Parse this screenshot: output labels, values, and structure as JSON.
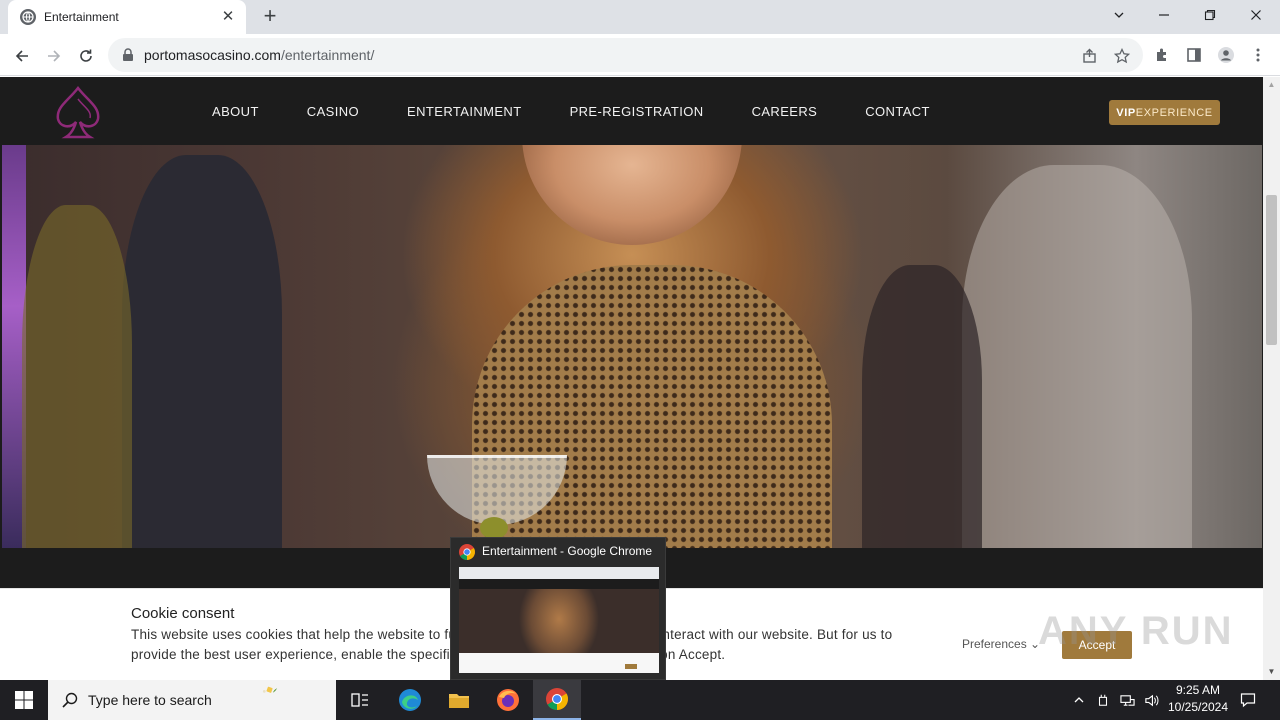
{
  "browser": {
    "tab_title": "Entertainment",
    "new_tab_label": "+",
    "url_host": "portomasocasino.com",
    "url_path": "/entertainment/"
  },
  "site": {
    "nav": [
      "ABOUT",
      "CASINO",
      "ENTERTAINMENT",
      "PRE-REGISTRATION",
      "CAREERS",
      "CONTACT"
    ],
    "vip_bold": "VIP",
    "vip_rest": "EXPERIENCE",
    "colors": {
      "header_bg": "#1c1c1c",
      "accent_gold": "#a07a3c",
      "logo_purple": "#8e2a78"
    }
  },
  "cookie": {
    "title": "Cookie consent",
    "text": "This website uses cookies that help the website to function and also to track how you interact with our website. But for us to provide the best user experience, enable the specific cookies from Settings, and click on Accept.",
    "preferences": "Preferences",
    "accept": "Accept"
  },
  "thumbnail": {
    "title": "Entertainment - Google Chrome"
  },
  "watermark": "ANY RUN",
  "taskbar": {
    "search_placeholder": "Type here to search",
    "time": "9:25 AM",
    "date": "10/25/2024"
  }
}
